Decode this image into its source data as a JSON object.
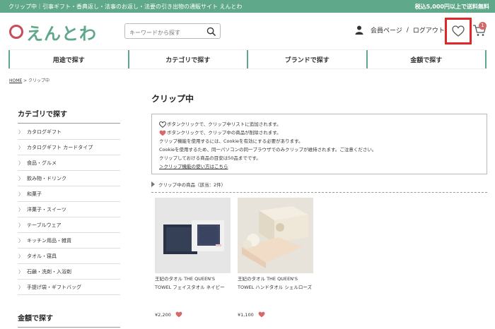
{
  "colors": {
    "brand_green": "#5fa889",
    "accent_red": "#c94c5b",
    "heart_pink": "#d56a6a",
    "highlight_box": "#e1262a"
  },
  "topbar": {
    "left_text": "クリップ中｜引事ギフト・香典返し・法事のお返し・法要の引き出物の通販サイト えんとわ",
    "right_text": "税込5,000円以上で送料無料"
  },
  "header": {
    "logo_text": "えんとわ",
    "search_placeholder": "キーワードから探す",
    "member_page": "会員ページ",
    "separator": "/",
    "logout": "ログアウト",
    "cart_count": "1"
  },
  "nav": [
    {
      "label": "用途で探す"
    },
    {
      "label": "カテゴリで探す"
    },
    {
      "label": "ブランドで探す"
    },
    {
      "label": "金額で探す"
    }
  ],
  "breadcrumb": {
    "home": "HOME",
    "separator": " > ",
    "current": "クリップ中"
  },
  "sidebar": {
    "category_title": "カテゴリで探す",
    "items": [
      {
        "label": "カタログギフト"
      },
      {
        "label": "カタログギフト カードタイプ"
      },
      {
        "label": "食品・グルメ"
      },
      {
        "label": "飲み物・ドリンク"
      },
      {
        "label": "和菓子"
      },
      {
        "label": "洋菓子・スイーツ"
      },
      {
        "label": "テーブルウェア"
      },
      {
        "label": "キッチン用品・雑貨"
      },
      {
        "label": "タオル・寝具"
      },
      {
        "label": "石鹸・洗剤・入浴剤"
      },
      {
        "label": "手提げ袋・ギフトバッグ"
      }
    ],
    "price_title": "金額で探す"
  },
  "main": {
    "title": "クリップ中",
    "info_lines": [
      "ボタンクリックで、クリップ中リストに追加されます。",
      "ボタンクリックで、クリップ中の商品が削除されます。",
      "クリップ機能を使用するには、Cookieを有効にする必要があります。",
      "Cookieを使用するため、同一パソコンの同一ブラウザでのみクリップが維持されます。ご注意ください。",
      "クリップしておける商品の目安は50品までです。"
    ],
    "info_link": "＞クリップ機能の使い方はこちら",
    "count_label": "クリップ中の商品（該当：2件）"
  },
  "products": [
    {
      "name": "王妃のタオル THE QUEEN'S TOWEL フェイスタオル ネイビー",
      "price": "¥2,200"
    },
    {
      "name": "王妃のタオル THE QUEEN'S TOWEL ハンドタオル シェルローズ",
      "price": "¥1,100"
    }
  ],
  "icons": {
    "search": "search-icon",
    "user": "user-icon",
    "heart": "heart-icon",
    "cart": "cart-icon",
    "chevron": "chevron-right-icon",
    "triangle": "triangle-right-icon"
  }
}
